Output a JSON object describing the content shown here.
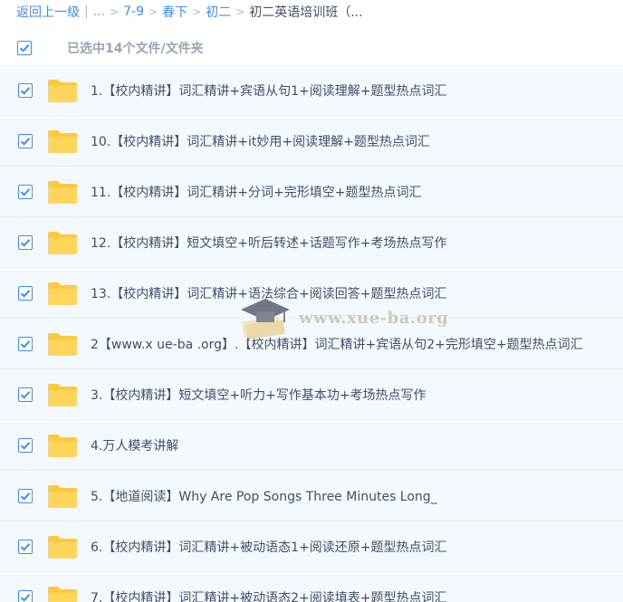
{
  "breadcrumb": {
    "back": "返回上一级",
    "ellipsis": "...",
    "items": [
      "7-9",
      "春下",
      "初二"
    ],
    "current": "初二英语培训班（..."
  },
  "selection": {
    "text": "已选中14个文件/文件夹"
  },
  "files": [
    "1.【校内精讲】词汇精讲+宾语从句1+阅读理解+题型热点词汇",
    "10.【校内精讲】词汇精讲+it妙用+阅读理解+题型热点词汇",
    "11.【校内精讲】词汇精讲+分词+完形填空+题型热点词汇",
    "12.【校内精讲】短文填空+听后转述+话题写作+考场热点写作",
    "13.【校内精讲】词汇精讲+语法综合+阅读回答+题型热点词汇",
    "2【www.x ue-ba .org】.【校内精讲】词汇精讲+宾语从句2+完形填空+题型热点词汇",
    "3.【校内精讲】短文填空+听力+写作基本功+考场热点写作",
    "4.万人模考讲解",
    "5.【地道阅读】Why Are Pop Songs Three Minutes Long_",
    "6.【校内精讲】词汇精讲+被动语态1+阅读还原+题型热点词汇",
    "7.【校内精讲】词汇精讲+被动语态2+阅读填表+题型热点词汇"
  ],
  "watermark": {
    "text": "www.xue-ba.org"
  },
  "colors": {
    "accent": "#3b8cff",
    "row_bg": "#f3f9ff",
    "folder": "#ffc93c"
  }
}
